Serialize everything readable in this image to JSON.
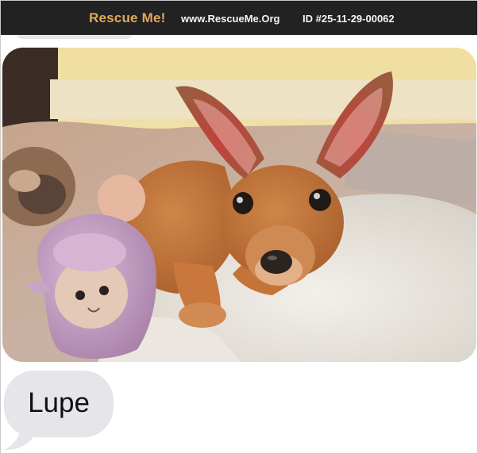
{
  "header": {
    "brand": "Rescue Me!",
    "site": "www.RescueMe.Org",
    "listing_id": "ID #25-11-29-00062"
  },
  "colors": {
    "header_bg": "#222222",
    "brand": "#e0a85a",
    "bubble": "#e5e5ea"
  },
  "photo": {
    "subject": "chihuahua-puppy-photo"
  },
  "message": {
    "name": "Lupe"
  }
}
